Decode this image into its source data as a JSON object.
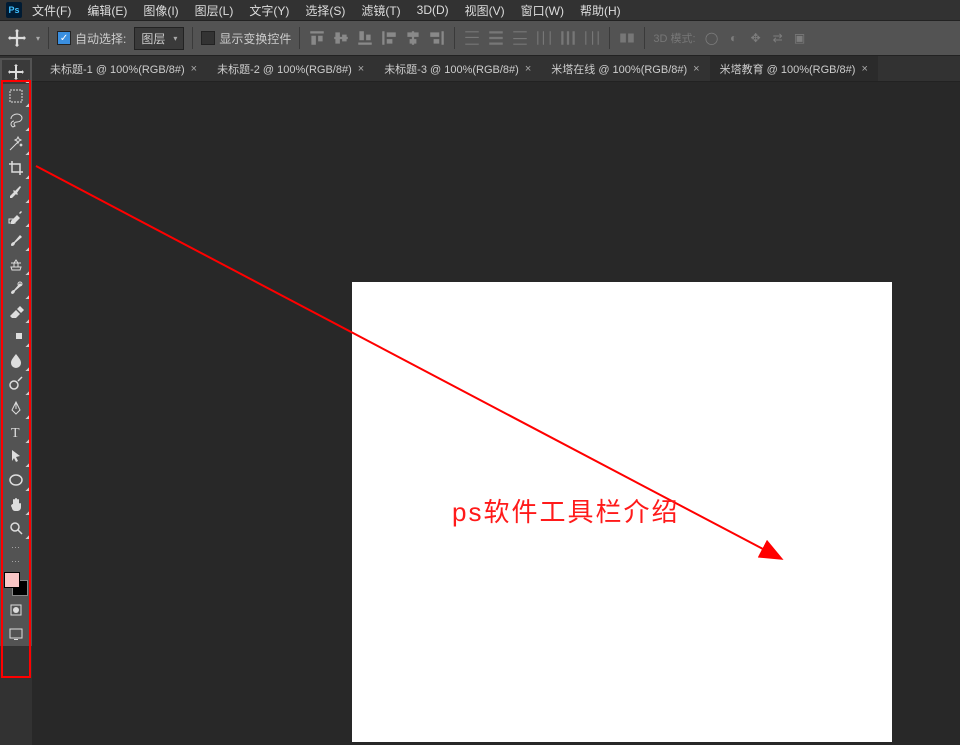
{
  "app_icon": "Ps",
  "menu": [
    "文件(F)",
    "编辑(E)",
    "图像(I)",
    "图层(L)",
    "文字(Y)",
    "选择(S)",
    "滤镜(T)",
    "3D(D)",
    "视图(V)",
    "窗口(W)",
    "帮助(H)"
  ],
  "optbar": {
    "auto_select_label": "自动选择:",
    "select_target": "图层",
    "show_transform_label": "显示变换控件",
    "mode3d_label": "3D 模式:"
  },
  "tabs": [
    {
      "label": "未标题-1 @ 100%(RGB/8#)",
      "active": false
    },
    {
      "label": "未标题-2 @ 100%(RGB/8#)",
      "active": false
    },
    {
      "label": "未标题-3 @ 100%(RGB/8#)",
      "active": false
    },
    {
      "label": "米塔在线 @ 100%(RGB/8#)",
      "active": false
    },
    {
      "label": "米塔教育 @ 100%(RGB/8#)",
      "active": true
    }
  ],
  "tools": [
    "move-tool",
    "marquee-tool",
    "lasso-tool",
    "magic-wand-tool",
    "crop-tool",
    "eyedropper-tool",
    "spot-healing-tool",
    "brush-tool",
    "clone-stamp-tool",
    "history-brush-tool",
    "eraser-tool",
    "gradient-tool",
    "blur-tool",
    "dodge-tool",
    "pen-tool",
    "type-tool",
    "path-selection-tool",
    "ellipse-tool",
    "hand-tool",
    "zoom-tool"
  ],
  "footer_tools": [
    "edit-toolbar",
    "quick-mask",
    "screen-mode"
  ],
  "swatch": {
    "fg": "#f9c6c6",
    "bg": "#000000"
  },
  "canvas_text": "ps软件工具栏介绍"
}
